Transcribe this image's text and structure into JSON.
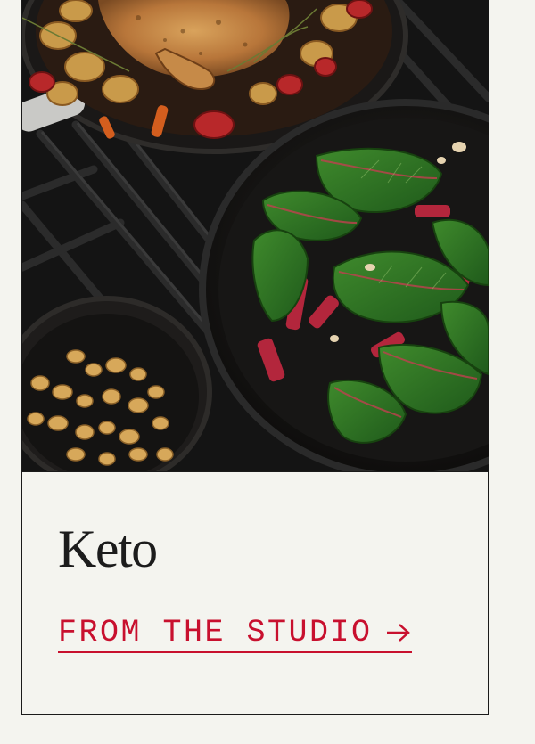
{
  "card": {
    "title": "Keto",
    "cta_label": "FROM THE STUDIO",
    "cta_icon": "arrow-right-icon",
    "image_description_icon": "food-photo"
  },
  "colors": {
    "background": "#f4f4ef",
    "border": "#1a1a1a",
    "title": "#1c1c1c",
    "accent": "#c8102e"
  }
}
